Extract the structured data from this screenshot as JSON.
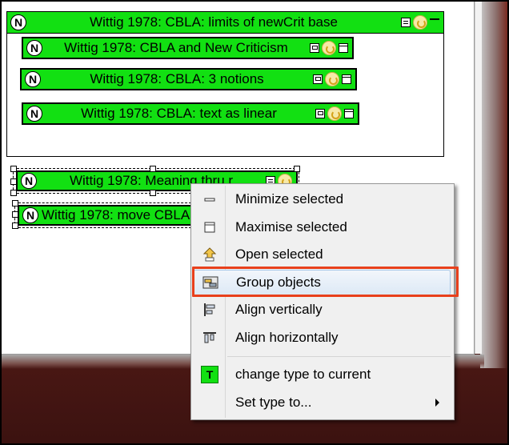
{
  "notes": {
    "container_title": "Wittig 1978: CBLA: limits of newCrit base",
    "inner": [
      "Wittig 1978: CBLA and New Criticism",
      "Wittig 1978: CBLA: 3 notions",
      "Wittig 1978: CBLA: text as linear"
    ],
    "selected": [
      "Wittig 1978: Meaning thru r",
      "Wittig 1978: move CBLA"
    ],
    "type_glyph": "N"
  },
  "context_menu": {
    "items": [
      {
        "label": "Minimize selected",
        "icon": "minimize-icon"
      },
      {
        "label": "Maximise selected",
        "icon": "maximise-icon"
      },
      {
        "label": "Open selected",
        "icon": "open-arrow-icon"
      },
      {
        "label": "Group objects",
        "icon": "group-icon",
        "highlighted": true
      },
      {
        "label": "Align vertically",
        "icon": "align-vertical-icon"
      },
      {
        "label": "Align horizontally",
        "icon": "align-horizontal-icon"
      },
      {
        "label": "change type to current",
        "icon": "type-t-icon"
      },
      {
        "label": "Set type to...",
        "icon": "",
        "submenu": true
      }
    ],
    "type_glyph": "T"
  },
  "colors": {
    "note_green": "#12e012",
    "highlight_outline": "#e8401c"
  }
}
